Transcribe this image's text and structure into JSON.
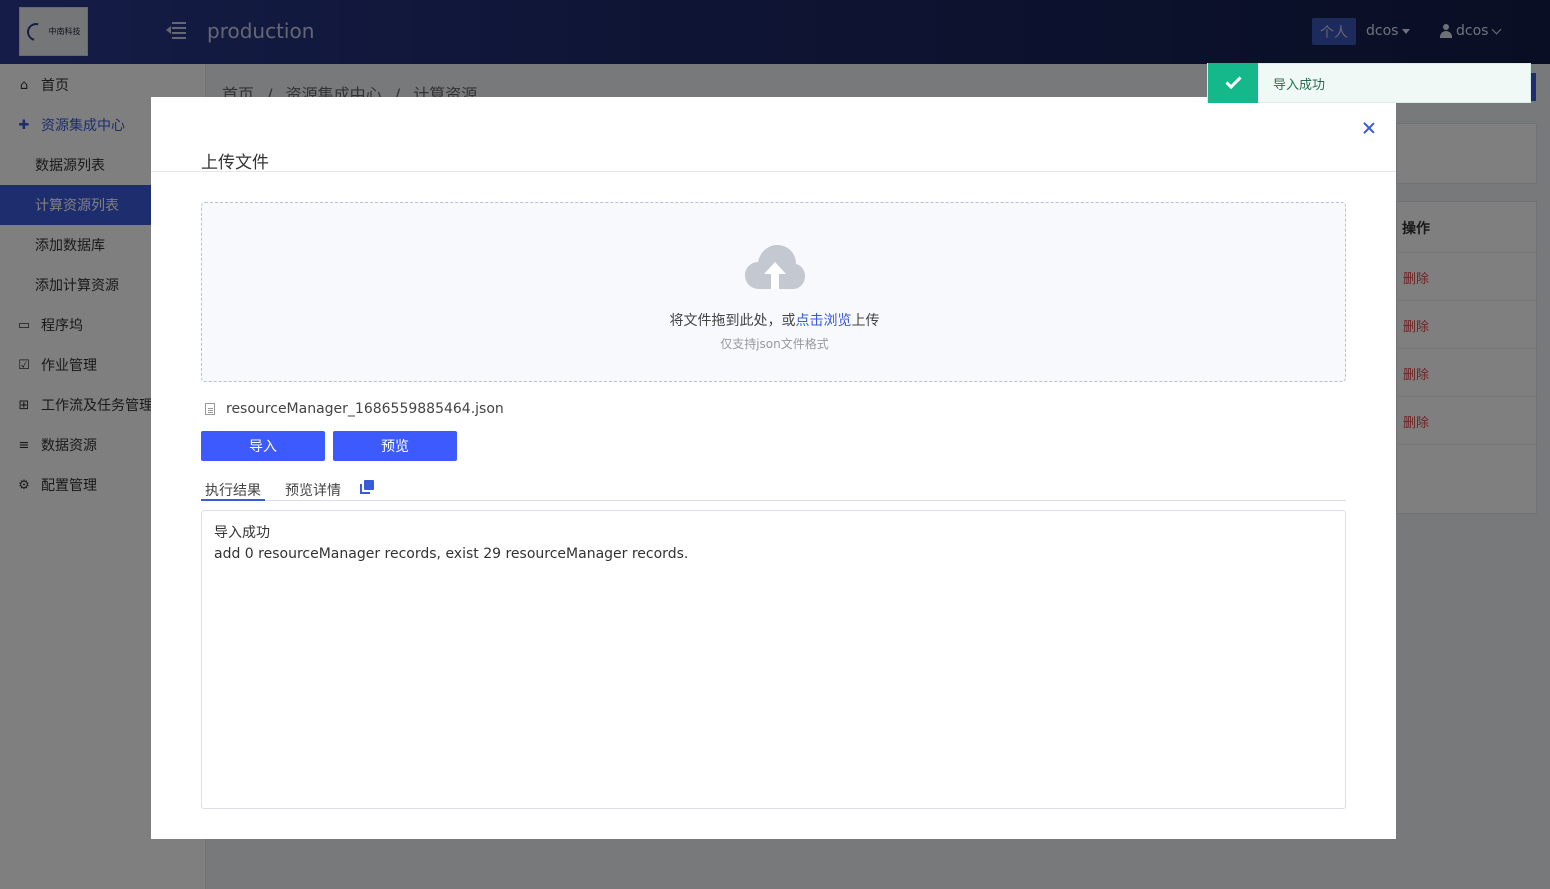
{
  "header": {
    "app_title": "production",
    "personal_label": "个人",
    "tenant_label": "dcos",
    "user_label": "dcos",
    "logo_text": "中南科技"
  },
  "sidebar": {
    "items": [
      {
        "label": "首页"
      },
      {
        "label": "资源集成中心"
      },
      {
        "label": "数据源列表"
      },
      {
        "label": "计算资源列表"
      },
      {
        "label": "添加数据库"
      },
      {
        "label": "添加计算资源"
      },
      {
        "label": "程序坞"
      },
      {
        "label": "作业管理"
      },
      {
        "label": "工作流及任务管理"
      },
      {
        "label": "数据资源"
      },
      {
        "label": "配置管理"
      }
    ]
  },
  "breadcrumb": [
    "首页",
    "/",
    "资源集成中心",
    "/",
    "计算资源"
  ],
  "background_table": {
    "header": "操作",
    "row_action": "删除"
  },
  "modal": {
    "title": "上传文件",
    "drop_text_before": "将文件拖到此处，或",
    "drop_link": "点击浏览",
    "drop_text_after": "上传",
    "drop_hint": "仅支持json文件格式",
    "file_name": "resourceManager_1686559885464.json",
    "import_button": "导入",
    "preview_button": "预览",
    "tabs": [
      "执行结果",
      "预览详情"
    ],
    "result_line1": "导入成功",
    "result_line2": "add 0 resourceManager records, exist 29 resourceManager records."
  },
  "toast": {
    "message": "导入成功"
  },
  "colors": {
    "accent": "#3d5afe",
    "success": "#14b88a",
    "danger": "#e04545"
  }
}
